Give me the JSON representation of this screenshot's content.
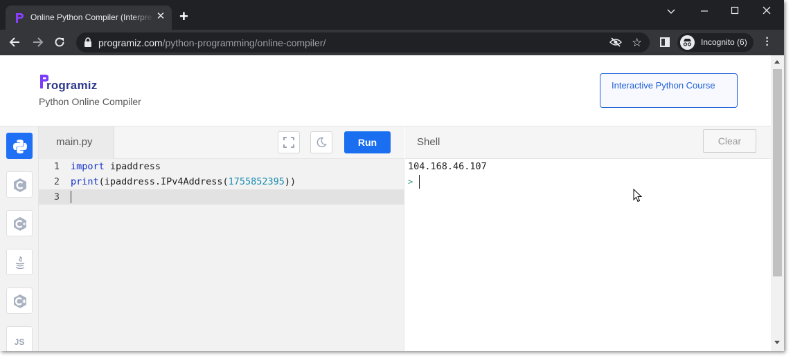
{
  "browser": {
    "tab_title": "Online Python Compiler (Interpreter) - Programiz",
    "new_tab": "+",
    "tab_close": "✕",
    "url_host": "programiz.com",
    "url_path": "/python-programming/online-compiler/",
    "profile_label": "Incognito (6)",
    "accent": "#202124"
  },
  "site": {
    "logo_text": "rogramiz",
    "subtitle": "Python Online Compiler",
    "course_button": "Interactive Python Course"
  },
  "editor": {
    "file_tab": "main.py",
    "run_label": "Run",
    "lines": [
      {
        "num": "1",
        "kw": "import",
        "rest": " ipaddress"
      },
      {
        "num": "2",
        "kw": "print",
        "rest": "(ipaddress.IPv4Address(",
        "number": "1755852395",
        "tail": "))"
      },
      {
        "num": "3"
      }
    ]
  },
  "shell": {
    "label": "Shell",
    "clear_label": "Clear",
    "output": "104.168.46.107",
    "prompt": ">"
  },
  "sidebar": {
    "languages": [
      "python-icon",
      "c-icon",
      "cpp-icon",
      "java-icon",
      "csharp-icon",
      "js-icon"
    ],
    "js_label": "JS"
  },
  "colors": {
    "run_button": "#1a6ff0",
    "active_language": "#1f70f5",
    "keyword": "#1030c8",
    "number": "#1a8caf"
  }
}
